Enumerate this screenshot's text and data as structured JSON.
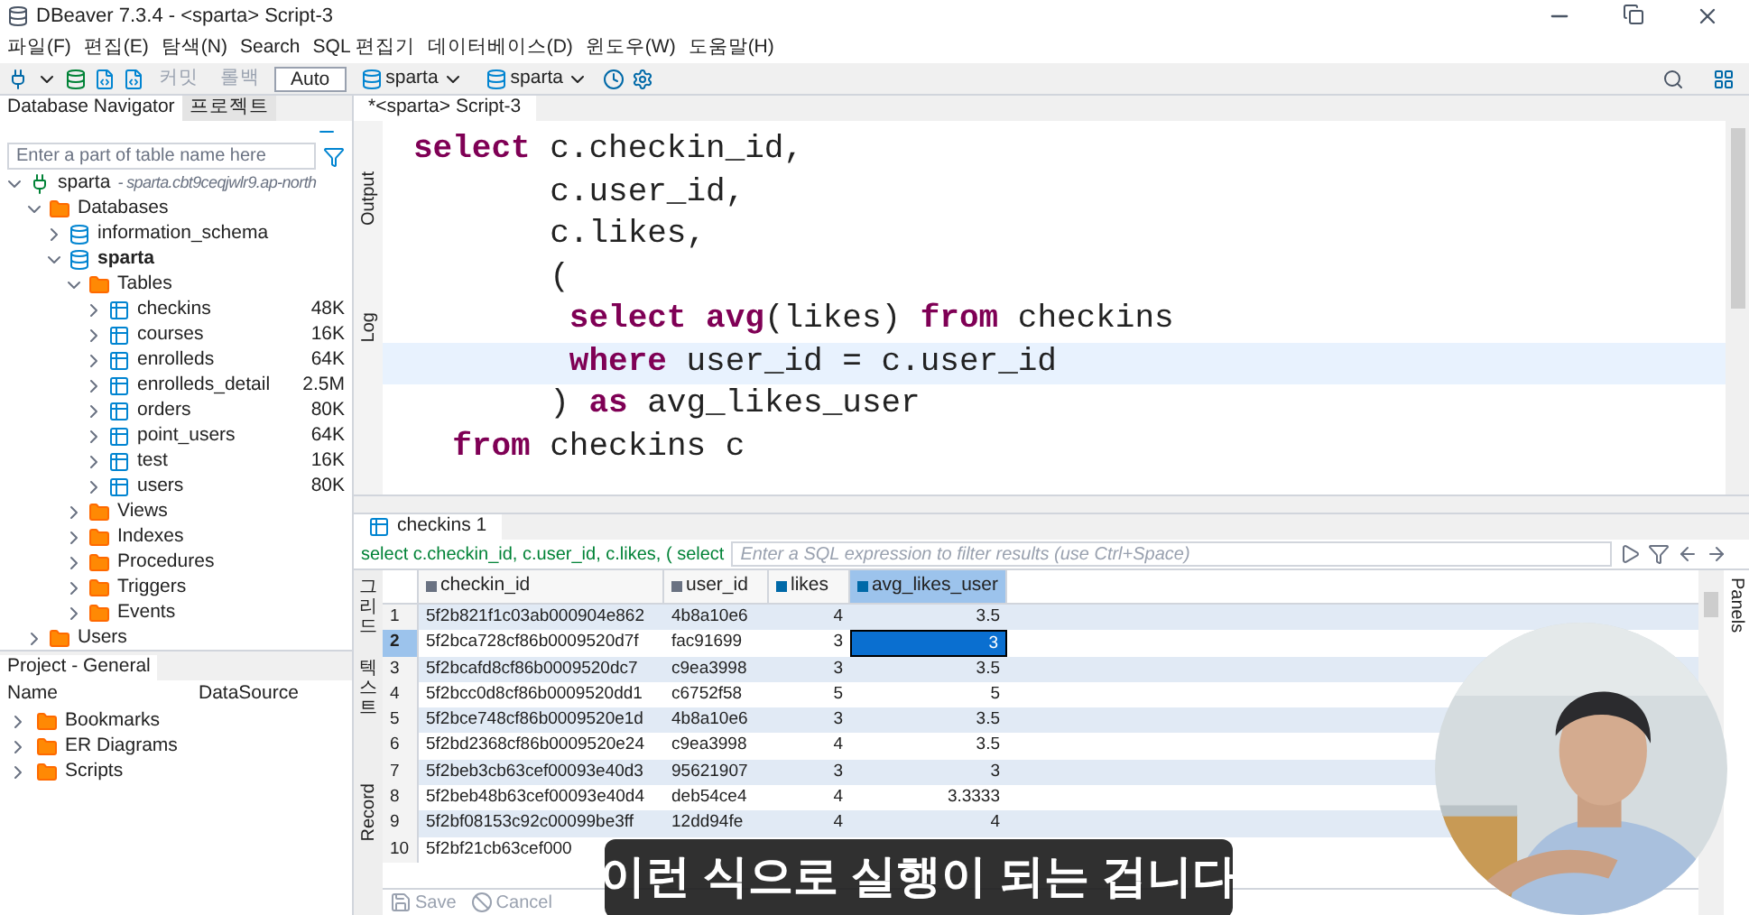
{
  "window": {
    "title": "DBeaver 7.3.4 - <sparta> Script-3"
  },
  "menu": [
    "파일(F)",
    "편집(E)",
    "탐색(N)",
    "Search",
    "SQL 편집기",
    "데이터베이스(D)",
    "윈도우(W)",
    "도움말(H)"
  ],
  "toolbar": [
    {
      "kind": "button",
      "label": "커밋",
      "disabled": true
    },
    {
      "kind": "button",
      "label": "롤백",
      "disabled": true
    },
    {
      "kind": "field",
      "label": "Auto"
    },
    {
      "kind": "combo",
      "label": "sparta"
    },
    {
      "kind": "combo",
      "label": "sparta"
    }
  ],
  "navigator": {
    "tabs": [
      {
        "label": "Database Navigator",
        "selected": true
      },
      {
        "label": "프로젝트",
        "selected": false
      }
    ],
    "search": {
      "placeholder": "Enter a part of table name here"
    },
    "tree": [
      {
        "label": "sparta",
        "suffix": "- sparta.cbt9ceqjwlr9.ap-north",
        "kind": "connection",
        "expanded": true,
        "children": [
          {
            "label": "Databases",
            "kind": "folder",
            "expanded": true,
            "children": [
              {
                "label": "information_schema",
                "kind": "database",
                "bold": false,
                "expanded": false
              },
              {
                "label": "sparta",
                "kind": "database",
                "bold": true,
                "expanded": true,
                "children": [
                  {
                    "label": "Tables",
                    "kind": "folder",
                    "expanded": true,
                    "children": [
                      {
                        "label": "checkins",
                        "kind": "table",
                        "size": "48K",
                        "expanded": false
                      },
                      {
                        "label": "courses",
                        "kind": "table",
                        "size": "16K",
                        "expanded": false
                      },
                      {
                        "label": "enrolleds",
                        "kind": "table",
                        "size": "64K",
                        "expanded": false
                      },
                      {
                        "label": "enrolleds_detail",
                        "kind": "table",
                        "size": "2.5M",
                        "expanded": false
                      },
                      {
                        "label": "orders",
                        "kind": "table",
                        "size": "80K",
                        "expanded": false
                      },
                      {
                        "label": "point_users",
                        "kind": "table",
                        "size": "64K",
                        "expanded": false
                      },
                      {
                        "label": "test",
                        "kind": "table",
                        "size": "16K",
                        "expanded": false
                      },
                      {
                        "label": "users",
                        "kind": "table",
                        "size": "80K",
                        "expanded": false
                      }
                    ]
                  },
                  {
                    "label": "Views",
                    "kind": "folder",
                    "expanded": false
                  },
                  {
                    "label": "Indexes",
                    "kind": "folder",
                    "expanded": false
                  },
                  {
                    "label": "Procedures",
                    "kind": "folder",
                    "expanded": false
                  },
                  {
                    "label": "Triggers",
                    "kind": "folder",
                    "expanded": false
                  },
                  {
                    "label": "Events",
                    "kind": "folder",
                    "expanded": false
                  }
                ]
              }
            ]
          },
          {
            "label": "Users",
            "kind": "folder",
            "expanded": false
          }
        ]
      }
    ]
  },
  "project": {
    "title": "Project - General",
    "columns": [
      "Name",
      "DataSource"
    ],
    "items": [
      {
        "label": "Bookmarks",
        "expanded": false
      },
      {
        "label": "ER Diagrams",
        "expanded": false
      },
      {
        "label": "Scripts",
        "expanded": false
      }
    ]
  },
  "editor": {
    "tab": "*<sparta> Script-3",
    "side_tabs": [
      "Output",
      "Log"
    ],
    "lines": [
      {
        "text": "**select** c.checkin_id,",
        "current": false
      },
      {
        "text": "       c.user_id,",
        "current": false
      },
      {
        "text": "       c.likes,",
        "current": false
      },
      {
        "text": "       (",
        "current": false
      },
      {
        "text": "        **select** **avg**(likes) **from** checkins",
        "current": false
      },
      {
        "text": "        **where** user_id = c.user_id",
        "current": true
      },
      {
        "text": "       ) **as** avg_likes_user",
        "current": false
      },
      {
        "text": "  **from** checkins c",
        "current": false
      }
    ]
  },
  "results": {
    "tab": "checkins 1",
    "query": "select c.checkin_id, c.user_id, c.likes, ( select",
    "filter": {
      "placeholder": "Enter a SQL expression to filter results (use Ctrl+Space)"
    },
    "side_tabs": [
      "그리드",
      "텍스트",
      "Record"
    ],
    "columns": [
      {
        "label": "checkin_id",
        "kind": "text",
        "selected": false
      },
      {
        "label": "user_id",
        "kind": "text",
        "selected": false
      },
      {
        "label": "likes",
        "kind": "number",
        "selected": false
      },
      {
        "label": "avg_likes_user",
        "kind": "number",
        "selected": true
      }
    ],
    "rows": [
      {
        "n": "1",
        "current": false,
        "cells": [
          {
            "v": "5f2b821f1c03ab000904e862",
            "selected": false
          },
          {
            "v": "4b8a10e6",
            "selected": false
          },
          {
            "v": "4",
            "selected": false
          },
          {
            "v": "3.5",
            "selected": false
          }
        ]
      },
      {
        "n": "2",
        "current": true,
        "cells": [
          {
            "v": "5f2bca728cf86b0009520d7f",
            "selected": false
          },
          {
            "v": "fac91699",
            "selected": false
          },
          {
            "v": "3",
            "selected": false
          },
          {
            "v": "3",
            "selected": true
          }
        ]
      },
      {
        "n": "3",
        "current": false,
        "cells": [
          {
            "v": "5f2bcafd8cf86b0009520dc7",
            "selected": false
          },
          {
            "v": "c9ea3998",
            "selected": false
          },
          {
            "v": "3",
            "selected": false
          },
          {
            "v": "3.5",
            "selected": false
          }
        ]
      },
      {
        "n": "4",
        "current": false,
        "cells": [
          {
            "v": "5f2bcc0d8cf86b0009520dd1",
            "selected": false
          },
          {
            "v": "c6752f58",
            "selected": false
          },
          {
            "v": "5",
            "selected": false
          },
          {
            "v": "5",
            "selected": false
          }
        ]
      },
      {
        "n": "5",
        "current": false,
        "cells": [
          {
            "v": "5f2bce748cf86b0009520e1d",
            "selected": false
          },
          {
            "v": "4b8a10e6",
            "selected": false
          },
          {
            "v": "3",
            "selected": false
          },
          {
            "v": "3.5",
            "selected": false
          }
        ]
      },
      {
        "n": "6",
        "current": false,
        "cells": [
          {
            "v": "5f2bd2368cf86b0009520e24",
            "selected": false
          },
          {
            "v": "c9ea3998",
            "selected": false
          },
          {
            "v": "4",
            "selected": false
          },
          {
            "v": "3.5",
            "selected": false
          }
        ]
      },
      {
        "n": "7",
        "current": false,
        "cells": [
          {
            "v": "5f2beb3cb63cef00093e40d3",
            "selected": false
          },
          {
            "v": "95621907",
            "selected": false
          },
          {
            "v": "3",
            "selected": false
          },
          {
            "v": "3",
            "selected": false
          }
        ]
      },
      {
        "n": "8",
        "current": false,
        "cells": [
          {
            "v": "5f2beb48b63cef00093e40d4",
            "selected": false
          },
          {
            "v": "deb54ce4",
            "selected": false
          },
          {
            "v": "4",
            "selected": false
          },
          {
            "v": "3.3333",
            "selected": false
          }
        ]
      },
      {
        "n": "9",
        "current": false,
        "cells": [
          {
            "v": "5f2bf08153c92c00099be3ff",
            "selected": false
          },
          {
            "v": "12dd94fe",
            "selected": false
          },
          {
            "v": "4",
            "selected": false
          },
          {
            "v": "4",
            "selected": false
          }
        ]
      },
      {
        "n": "10",
        "current": false,
        "cells": [
          {
            "v": "5f2bf21cb63cef000",
            "selected": false
          }
        ]
      }
    ],
    "actions": [
      "Save",
      "Cancel"
    ],
    "right_tabs": [
      "Panels"
    ]
  },
  "subtitle": "이런 식으로 실행이 되는 겁니다"
}
